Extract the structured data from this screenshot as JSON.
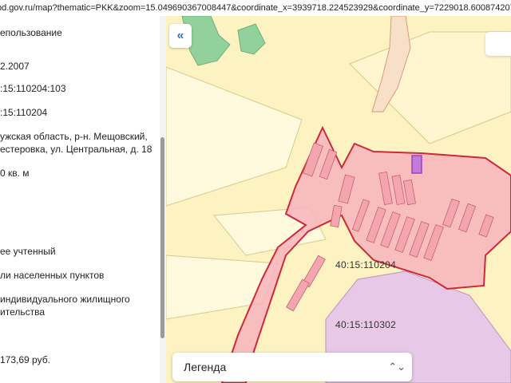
{
  "browser": {
    "url": "pd.gov.ru/map?thematic=PKK&zoom=15.049690367008447&coordinate_x=3939718.224523929&coordinate_y=7229018.600874207&theme_id..."
  },
  "info_panel": {
    "lines": [
      "епользование",
      "2.2007",
      ":15:110204:103",
      ":15:110204",
      "ужская область, р-н. Мещовский,",
      "естеровка, ул. Центральная, д. 18",
      "0 кв. м",
      "ее учтенный",
      "ли населенных пунктов",
      "индивидуального жилищного",
      "ительства",
      "173,69 руб."
    ]
  },
  "map": {
    "collapse_icon": "double-chevron-left-icon",
    "cadastral_labels": [
      "40:15:110204",
      "40:15:110302"
    ],
    "legend": {
      "label": "Легенда",
      "icon": "chevron-up-down-icon"
    },
    "colors": {
      "land": "#fdf3c2",
      "forest": "#92d19c",
      "settlement_fill": "#f7b4bd",
      "settlement_border": "#cc2a3b",
      "neighbor_zone": "#e7c8e6",
      "selected_parcel": "#a040c0",
      "link_blue": "#3b6bd6"
    }
  }
}
